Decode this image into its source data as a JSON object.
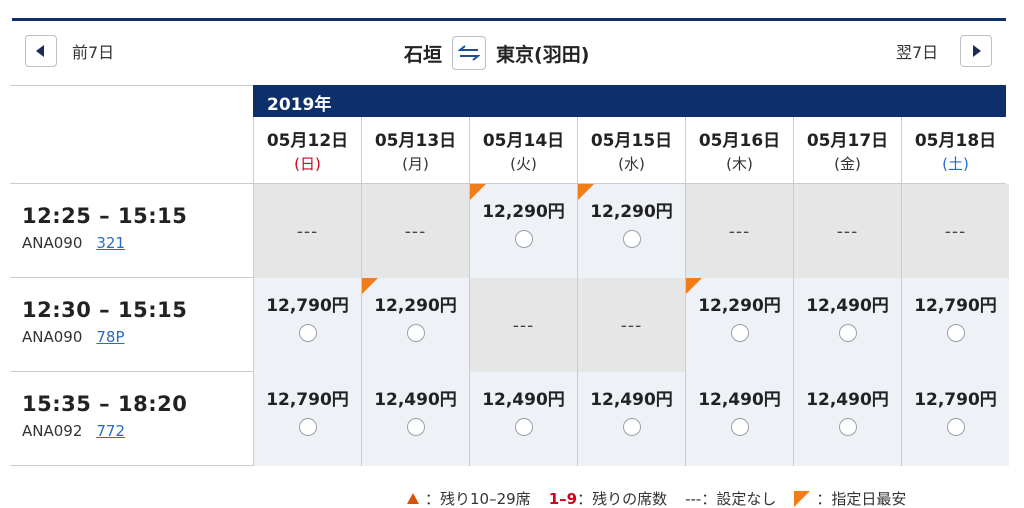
{
  "nav": {
    "prev_label": "前7日",
    "next_label": "翌7日",
    "from_city": "石垣",
    "to_city": "東京(羽田)"
  },
  "year": "2019年",
  "dates": [
    {
      "date": "05月12日",
      "weekday": "(日)",
      "type": "sun"
    },
    {
      "date": "05月13日",
      "weekday": "(月)",
      "type": "normal"
    },
    {
      "date": "05月14日",
      "weekday": "(火)",
      "type": "normal"
    },
    {
      "date": "05月15日",
      "weekday": "(水)",
      "type": "normal"
    },
    {
      "date": "05月16日",
      "weekday": "(木)",
      "type": "normal"
    },
    {
      "date": "05月17日",
      "weekday": "(金)",
      "type": "normal"
    },
    {
      "date": "05月18日",
      "weekday": "(土)",
      "type": "sat"
    }
  ],
  "flights": [
    {
      "time": "12:25 – 15:15",
      "code": "ANA090",
      "aircraft": "321",
      "cells": [
        {
          "price": null,
          "dash": "---",
          "cheapest": false
        },
        {
          "price": null,
          "dash": "---",
          "cheapest": false
        },
        {
          "price": "12,290円",
          "cheapest": true
        },
        {
          "price": "12,290円",
          "cheapest": true
        },
        {
          "price": null,
          "dash": "---",
          "cheapest": false
        },
        {
          "price": null,
          "dash": "---",
          "cheapest": false
        },
        {
          "price": null,
          "dash": "---",
          "cheapest": false
        }
      ]
    },
    {
      "time": "12:30 – 15:15",
      "code": "ANA090",
      "aircraft": "78P",
      "cells": [
        {
          "price": "12,790円",
          "cheapest": false
        },
        {
          "price": "12,290円",
          "cheapest": true
        },
        {
          "price": null,
          "dash": "---",
          "cheapest": false
        },
        {
          "price": null,
          "dash": "---",
          "cheapest": false
        },
        {
          "price": "12,290円",
          "cheapest": true
        },
        {
          "price": "12,490円",
          "cheapest": false
        },
        {
          "price": "12,790円",
          "cheapest": false
        }
      ]
    },
    {
      "time": "15:35 – 18:20",
      "code": "ANA092",
      "aircraft": "772",
      "cells": [
        {
          "price": "12,790円",
          "cheapest": false
        },
        {
          "price": "12,490円",
          "cheapest": false
        },
        {
          "price": "12,490円",
          "cheapest": false
        },
        {
          "price": "12,490円",
          "cheapest": false
        },
        {
          "price": "12,490円",
          "cheapest": false
        },
        {
          "price": "12,490円",
          "cheapest": false
        },
        {
          "price": "12,790円",
          "cheapest": false
        }
      ]
    }
  ],
  "legend": {
    "few_seats": "：残り10–29席",
    "count_value": "1–9",
    "count_label": "：残りの席数",
    "none_value": "---",
    "none_label": "：設定なし",
    "cheapest_label": "：指定日最安"
  },
  "colors": {
    "navy": "#0d2f6b",
    "cheapest_marker": "#f07d18",
    "sunday": "#d0021b",
    "saturday": "#2a6cc4"
  }
}
